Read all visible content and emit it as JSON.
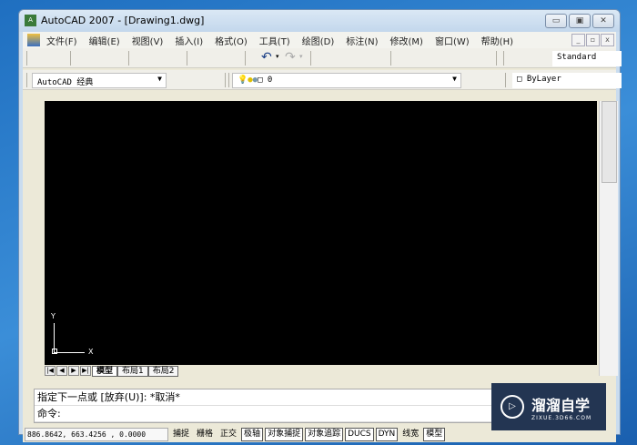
{
  "window": {
    "title": "AutoCAD 2007 - [Drawing1.dwg]"
  },
  "menu": [
    "文件(F)",
    "编辑(E)",
    "视图(V)",
    "插入(I)",
    "格式(O)",
    "工具(T)",
    "绘图(D)",
    "标注(N)",
    "修改(M)",
    "窗口(W)",
    "帮助(H)"
  ],
  "toolbar": {
    "text_style": "Standard",
    "workspace": "AutoCAD 经典",
    "layer": "0",
    "color": "ByLayer"
  },
  "tabs": [
    "模型",
    "布局1",
    "布局2"
  ],
  "ucs": {
    "y": "Y",
    "x": "X"
  },
  "command": {
    "history": "指定下一点或 [放弃(U)]: *取消*",
    "prompt": "命令:"
  },
  "status": {
    "coords": "886.8642,  663.4256 , 0.0000",
    "buttons": [
      "捕捉",
      "栅格",
      "正交",
      "极轴",
      "对象捕捉",
      "对象追踪",
      "DUCS",
      "DYN",
      "线宽",
      "模型"
    ]
  },
  "watermark": {
    "name": "溜溜自学",
    "url": "ZIXUE.3D66.COM"
  }
}
